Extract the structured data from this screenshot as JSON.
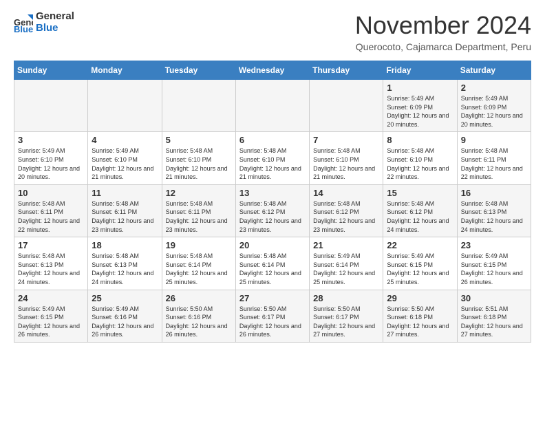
{
  "logo": {
    "general": "General",
    "blue": "Blue"
  },
  "title": "November 2024",
  "location": "Querocoto, Cajamarca Department, Peru",
  "days_of_week": [
    "Sunday",
    "Monday",
    "Tuesday",
    "Wednesday",
    "Thursday",
    "Friday",
    "Saturday"
  ],
  "weeks": [
    [
      {
        "day": "",
        "info": ""
      },
      {
        "day": "",
        "info": ""
      },
      {
        "day": "",
        "info": ""
      },
      {
        "day": "",
        "info": ""
      },
      {
        "day": "",
        "info": ""
      },
      {
        "day": "1",
        "info": "Sunrise: 5:49 AM\nSunset: 6:09 PM\nDaylight: 12 hours and 20 minutes."
      },
      {
        "day": "2",
        "info": "Sunrise: 5:49 AM\nSunset: 6:09 PM\nDaylight: 12 hours and 20 minutes."
      }
    ],
    [
      {
        "day": "3",
        "info": "Sunrise: 5:49 AM\nSunset: 6:10 PM\nDaylight: 12 hours and 20 minutes."
      },
      {
        "day": "4",
        "info": "Sunrise: 5:49 AM\nSunset: 6:10 PM\nDaylight: 12 hours and 21 minutes."
      },
      {
        "day": "5",
        "info": "Sunrise: 5:48 AM\nSunset: 6:10 PM\nDaylight: 12 hours and 21 minutes."
      },
      {
        "day": "6",
        "info": "Sunrise: 5:48 AM\nSunset: 6:10 PM\nDaylight: 12 hours and 21 minutes."
      },
      {
        "day": "7",
        "info": "Sunrise: 5:48 AM\nSunset: 6:10 PM\nDaylight: 12 hours and 21 minutes."
      },
      {
        "day": "8",
        "info": "Sunrise: 5:48 AM\nSunset: 6:10 PM\nDaylight: 12 hours and 22 minutes."
      },
      {
        "day": "9",
        "info": "Sunrise: 5:48 AM\nSunset: 6:11 PM\nDaylight: 12 hours and 22 minutes."
      }
    ],
    [
      {
        "day": "10",
        "info": "Sunrise: 5:48 AM\nSunset: 6:11 PM\nDaylight: 12 hours and 22 minutes."
      },
      {
        "day": "11",
        "info": "Sunrise: 5:48 AM\nSunset: 6:11 PM\nDaylight: 12 hours and 23 minutes."
      },
      {
        "day": "12",
        "info": "Sunrise: 5:48 AM\nSunset: 6:11 PM\nDaylight: 12 hours and 23 minutes."
      },
      {
        "day": "13",
        "info": "Sunrise: 5:48 AM\nSunset: 6:12 PM\nDaylight: 12 hours and 23 minutes."
      },
      {
        "day": "14",
        "info": "Sunrise: 5:48 AM\nSunset: 6:12 PM\nDaylight: 12 hours and 23 minutes."
      },
      {
        "day": "15",
        "info": "Sunrise: 5:48 AM\nSunset: 6:12 PM\nDaylight: 12 hours and 24 minutes."
      },
      {
        "day": "16",
        "info": "Sunrise: 5:48 AM\nSunset: 6:13 PM\nDaylight: 12 hours and 24 minutes."
      }
    ],
    [
      {
        "day": "17",
        "info": "Sunrise: 5:48 AM\nSunset: 6:13 PM\nDaylight: 12 hours and 24 minutes."
      },
      {
        "day": "18",
        "info": "Sunrise: 5:48 AM\nSunset: 6:13 PM\nDaylight: 12 hours and 24 minutes."
      },
      {
        "day": "19",
        "info": "Sunrise: 5:48 AM\nSunset: 6:14 PM\nDaylight: 12 hours and 25 minutes."
      },
      {
        "day": "20",
        "info": "Sunrise: 5:48 AM\nSunset: 6:14 PM\nDaylight: 12 hours and 25 minutes."
      },
      {
        "day": "21",
        "info": "Sunrise: 5:49 AM\nSunset: 6:14 PM\nDaylight: 12 hours and 25 minutes."
      },
      {
        "day": "22",
        "info": "Sunrise: 5:49 AM\nSunset: 6:15 PM\nDaylight: 12 hours and 25 minutes."
      },
      {
        "day": "23",
        "info": "Sunrise: 5:49 AM\nSunset: 6:15 PM\nDaylight: 12 hours and 26 minutes."
      }
    ],
    [
      {
        "day": "24",
        "info": "Sunrise: 5:49 AM\nSunset: 6:15 PM\nDaylight: 12 hours and 26 minutes."
      },
      {
        "day": "25",
        "info": "Sunrise: 5:49 AM\nSunset: 6:16 PM\nDaylight: 12 hours and 26 minutes."
      },
      {
        "day": "26",
        "info": "Sunrise: 5:50 AM\nSunset: 6:16 PM\nDaylight: 12 hours and 26 minutes."
      },
      {
        "day": "27",
        "info": "Sunrise: 5:50 AM\nSunset: 6:17 PM\nDaylight: 12 hours and 26 minutes."
      },
      {
        "day": "28",
        "info": "Sunrise: 5:50 AM\nSunset: 6:17 PM\nDaylight: 12 hours and 27 minutes."
      },
      {
        "day": "29",
        "info": "Sunrise: 5:50 AM\nSunset: 6:18 PM\nDaylight: 12 hours and 27 minutes."
      },
      {
        "day": "30",
        "info": "Sunrise: 5:51 AM\nSunset: 6:18 PM\nDaylight: 12 hours and 27 minutes."
      }
    ]
  ]
}
